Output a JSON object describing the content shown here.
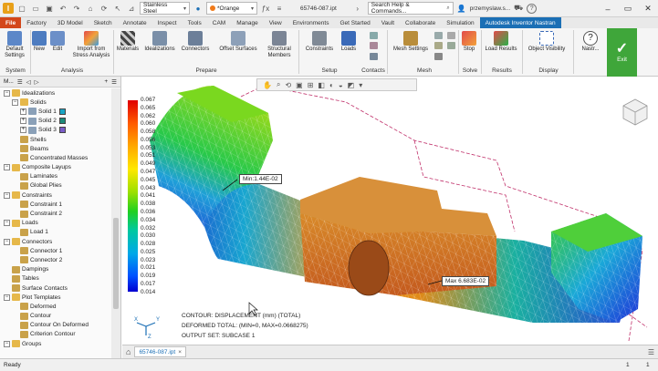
{
  "titlebar": {
    "material": "Stainless Steel",
    "appearance": "*Orange",
    "filename": "65746-087.ipt",
    "search_placeholder": "Search Help & Commands...",
    "user": "przemyslaw.s...",
    "help_label": "?",
    "window_controls": [
      "–",
      "▭",
      "✕"
    ]
  },
  "tabs": [
    "File",
    "Factory",
    "3D Model",
    "Sketch",
    "Annotate",
    "Inspect",
    "Tools",
    "CAM",
    "Manage",
    "View",
    "Environments",
    "Get Started",
    "Vault",
    "Collaborate",
    "Simulation",
    "Autodesk Inventor Nastran"
  ],
  "active_tab": "Autodesk Inventor Nastran",
  "ribbon": {
    "buttons": {
      "default_settings": "Default Settings",
      "new": "New",
      "edit": "Edit",
      "import_stress": "Import from Stress Analysis",
      "materials": "Materials",
      "idealizations": "Idealizations",
      "connectors": "Connectors",
      "offset_surfaces": "Offset Surfaces",
      "structural_members": "Structural Members",
      "constraints": "Constraints",
      "loads": "Loads",
      "mesh_settings": "Mesh Settings",
      "stop": "Stop",
      "load_results": "Load Results",
      "object_visibility": "Object Visibility",
      "nastran": "Nastr...",
      "exit": "Exit"
    },
    "groups": [
      "System",
      "Analysis",
      "Prepare",
      "Setup",
      "Contacts",
      "Mesh",
      "Solve",
      "Results",
      "Display"
    ]
  },
  "browser": {
    "toolbar": [
      "M...",
      "☰",
      "◁",
      "▷",
      "+",
      "☰"
    ],
    "tree": [
      {
        "label": "Idealizations",
        "level": 1,
        "toggle": "−",
        "icon": "folder"
      },
      {
        "label": "Solids",
        "level": 2,
        "toggle": "−",
        "icon": "folder"
      },
      {
        "label": "Solid 1",
        "level": 3,
        "toggle": "+",
        "icon": "solid",
        "swatch": "#1aa5c4"
      },
      {
        "label": "Solid 2",
        "level": 3,
        "toggle": "+",
        "icon": "solid",
        "swatch": "#1d8a7a"
      },
      {
        "label": "Solid 3",
        "level": 3,
        "toggle": "+",
        "icon": "solid",
        "swatch": "#7a5cc8"
      },
      {
        "label": "Shells",
        "level": 2,
        "toggle": "",
        "icon": "item"
      },
      {
        "label": "Beams",
        "level": 2,
        "toggle": "",
        "icon": "item"
      },
      {
        "label": "Concentrated Masses",
        "level": 2,
        "toggle": "",
        "icon": "item"
      },
      {
        "label": "Composite Layups",
        "level": 1,
        "toggle": "−",
        "icon": "folder"
      },
      {
        "label": "Laminates",
        "level": 2,
        "toggle": "",
        "icon": "item"
      },
      {
        "label": "Global Plies",
        "level": 2,
        "toggle": "",
        "icon": "item"
      },
      {
        "label": "Constraints",
        "level": 1,
        "toggle": "−",
        "icon": "folder"
      },
      {
        "label": "Constraint 1",
        "level": 2,
        "toggle": "",
        "icon": "item"
      },
      {
        "label": "Constraint 2",
        "level": 2,
        "toggle": "",
        "icon": "item"
      },
      {
        "label": "Loads",
        "level": 1,
        "toggle": "−",
        "icon": "folder"
      },
      {
        "label": "Load 1",
        "level": 2,
        "toggle": "",
        "icon": "item"
      },
      {
        "label": "Connectors",
        "level": 1,
        "toggle": "−",
        "icon": "folder"
      },
      {
        "label": "Connector 1",
        "level": 2,
        "toggle": "",
        "icon": "item"
      },
      {
        "label": "Connector 2",
        "level": 2,
        "toggle": "",
        "icon": "item"
      },
      {
        "label": "Dampings",
        "level": 1,
        "toggle": "",
        "icon": "item"
      },
      {
        "label": "Tables",
        "level": 1,
        "toggle": "",
        "icon": "item"
      },
      {
        "label": "Surface Contacts",
        "level": 1,
        "toggle": "",
        "icon": "item"
      },
      {
        "label": "Plot Templates",
        "level": 1,
        "toggle": "−",
        "icon": "folder"
      },
      {
        "label": "Deformed",
        "level": 2,
        "toggle": "",
        "icon": "item"
      },
      {
        "label": "Contour",
        "level": 2,
        "toggle": "",
        "icon": "item"
      },
      {
        "label": "Contour On Deformed",
        "level": 2,
        "toggle": "",
        "icon": "item"
      },
      {
        "label": "Criterion Contour",
        "level": 2,
        "toggle": "",
        "icon": "item"
      },
      {
        "label": "Groups",
        "level": 1,
        "toggle": "−",
        "icon": "folder"
      }
    ]
  },
  "legend": {
    "values": [
      "0.067",
      "0.065",
      "0.062",
      "0.060",
      "0.058",
      "0.056",
      "0.053",
      "0.051",
      "0.049",
      "0.047",
      "0.045",
      "0.043",
      "0.041",
      "0.038",
      "0.036",
      "0.034",
      "0.032",
      "0.030",
      "0.028",
      "0.025",
      "0.023",
      "0.021",
      "0.019",
      "0.017",
      "0.014"
    ]
  },
  "viewport": {
    "min_label": "Min:1.44E-02",
    "max_label": "Max 6.683E-02",
    "info_lines": [
      "CONTOUR: DISPLACEMENT (mm) (TOTAL)",
      "DEFORMED TOTAL: (MIN=0, MAX=0.0668275)",
      "OUTPUT SET: SUBCASE 1"
    ],
    "axes": {
      "x": "X",
      "y": "Y",
      "z": "Z"
    }
  },
  "doc_tabs": [
    "65746-087.ipt"
  ],
  "status": {
    "text": "Ready",
    "count_a": "1",
    "count_b": "1"
  }
}
